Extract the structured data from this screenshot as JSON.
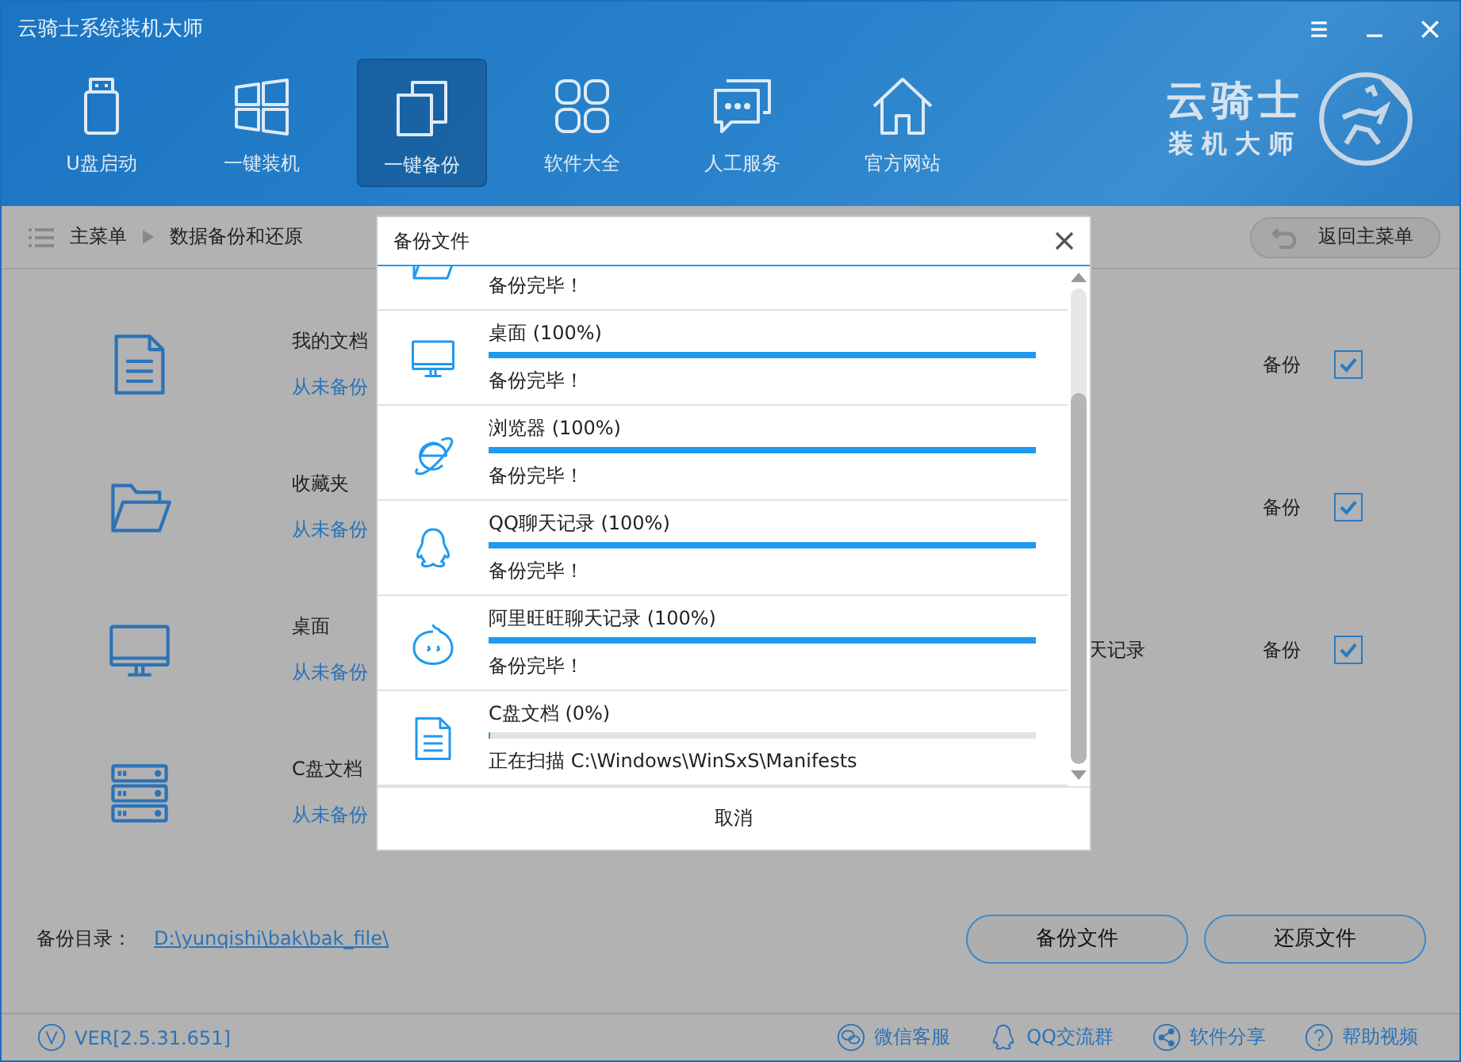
{
  "window": {
    "title": "云骑士系统装机大师"
  },
  "toolbar": [
    {
      "label": "U盘启动",
      "selected": false
    },
    {
      "label": "一键装机",
      "selected": false
    },
    {
      "label": "一键备份",
      "selected": true
    },
    {
      "label": "软件大全",
      "selected": false
    },
    {
      "label": "人工服务",
      "selected": false
    },
    {
      "label": "官方网站",
      "selected": false
    }
  ],
  "logo": {
    "name": "云骑士",
    "subtitle": "装机大师"
  },
  "breadcrumb": {
    "root": "主菜单",
    "current": "数据备份和还原"
  },
  "back_button": "返回主菜单",
  "backup_rows": [
    {
      "name": "我的文档",
      "status": "从未备份",
      "option_label": "备份",
      "checked": true
    },
    {
      "name": "收藏夹",
      "status": "从未备份",
      "option_label": "备份",
      "checked": true
    },
    {
      "name": "桌面",
      "status": "从未备份",
      "column_2": "天记录",
      "option_label": "备份",
      "checked": true
    },
    {
      "name": "C盘文档",
      "status": "从未备份"
    }
  ],
  "backup_dir": {
    "label": "备份目录：",
    "path": "D:\\yunqishi\\bak\\bak_file\\"
  },
  "buttons": [
    "备份文件",
    "还原文件"
  ],
  "footer": {
    "version": "VER[2.5.31.651]",
    "links": [
      "微信客服",
      "QQ交流群",
      "软件分享",
      "帮助视频"
    ]
  },
  "dialog": {
    "title": "备份文件",
    "items": [
      {
        "kind": "cut",
        "status": "备份完毕！"
      },
      {
        "kind": "full",
        "name": "桌面 (100%)",
        "level": 1,
        "status": "备份完毕！"
      },
      {
        "kind": "full",
        "name": "浏览器 (100%)",
        "level": 1,
        "status": "备份完毕！"
      },
      {
        "kind": "full",
        "name": "QQ聊天记录 (100%)",
        "level": 1,
        "status": "备份完毕！"
      },
      {
        "kind": "full",
        "name": "阿里旺旺聊天记录 (100%)",
        "level": 1,
        "status": "备份完毕！"
      },
      {
        "kind": "full",
        "name": "C盘文档 (0%)",
        "level": 0,
        "status": "正在扫描 C:\\Windows\\WinSxS\\Manifests"
      }
    ],
    "cancel": "取消"
  }
}
